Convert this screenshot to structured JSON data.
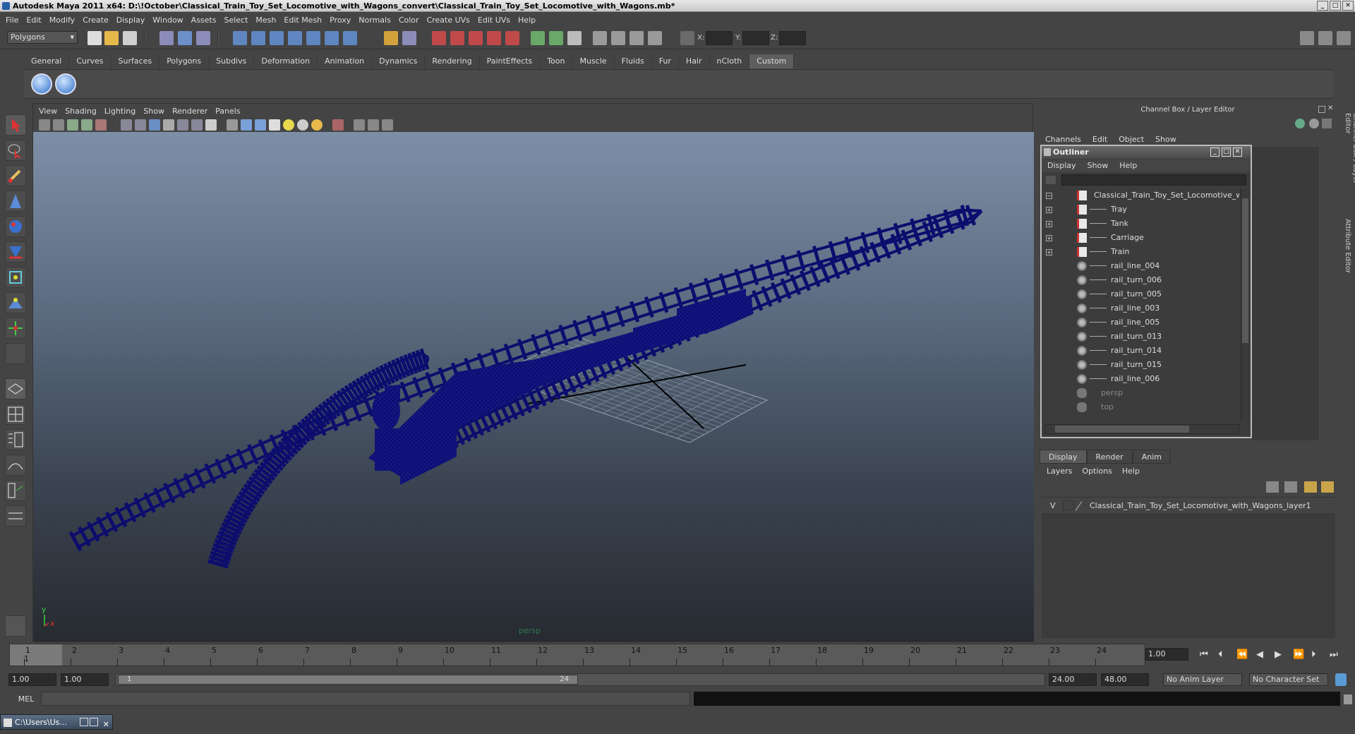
{
  "window": {
    "title": "Autodesk Maya 2011 x64: D:\\!October\\Classical_Train_Toy_Set_Locomotive_with_Wagons_convert\\Classical_Train_Toy_Set_Locomotive_with_Wagons.mb*",
    "minimize": "_",
    "maximize": "□",
    "close": "✕"
  },
  "menubar": [
    "File",
    "Edit",
    "Modify",
    "Create",
    "Display",
    "Window",
    "Assets",
    "Select",
    "Mesh",
    "Edit Mesh",
    "Proxy",
    "Normals",
    "Color",
    "Create UVs",
    "Edit UVs",
    "Help"
  ],
  "statusline": {
    "mode": "Polygons",
    "x_label": "X:",
    "y_label": "Y:",
    "z_label": "Z:"
  },
  "shelf": {
    "tabs": [
      "General",
      "Curves",
      "Surfaces",
      "Polygons",
      "Subdivs",
      "Deformation",
      "Animation",
      "Dynamics",
      "Rendering",
      "PaintEffects",
      "Toon",
      "Muscle",
      "Fluids",
      "Fur",
      "Hair",
      "nCloth",
      "Custom"
    ],
    "active_tab": "Custom"
  },
  "viewport": {
    "menu": [
      "View",
      "Shading",
      "Lighting",
      "Show",
      "Renderer",
      "Panels"
    ],
    "camera_label": "persp",
    "axis_y": "y",
    "axis_x": "x",
    "mesh_color": "#0d0d6e"
  },
  "channel_box": {
    "header": "Channel Box / Layer Editor",
    "menu": [
      "Channels",
      "Edit",
      "Object",
      "Show"
    ],
    "side_tab_1": "Channel Box / Layer Editor",
    "side_tab_2": "Attribute Editor"
  },
  "outliner": {
    "title": "Outliner",
    "menu": [
      "Display",
      "Show",
      "Help"
    ],
    "items": [
      {
        "label": "Classical_Train_Toy_Set_Locomotive_with",
        "expander": "−",
        "icon": "group",
        "indent": 0
      },
      {
        "label": "Tray",
        "expander": "+",
        "icon": "group",
        "indent": 1
      },
      {
        "label": "Tank",
        "expander": "+",
        "icon": "group",
        "indent": 1
      },
      {
        "label": "Carriage",
        "expander": "+",
        "icon": "group",
        "indent": 1
      },
      {
        "label": "Train",
        "expander": "+",
        "icon": "group",
        "indent": 1
      },
      {
        "label": "rail_line_004",
        "expander": "",
        "icon": "mesh",
        "indent": 1
      },
      {
        "label": "rail_turn_006",
        "expander": "",
        "icon": "mesh",
        "indent": 1
      },
      {
        "label": "rail_turn_005",
        "expander": "",
        "icon": "mesh",
        "indent": 1
      },
      {
        "label": "rail_line_003",
        "expander": "",
        "icon": "mesh",
        "indent": 1
      },
      {
        "label": "rail_line_005",
        "expander": "",
        "icon": "mesh",
        "indent": 1
      },
      {
        "label": "rail_turn_013",
        "expander": "",
        "icon": "mesh",
        "indent": 1
      },
      {
        "label": "rail_turn_014",
        "expander": "",
        "icon": "mesh",
        "indent": 1
      },
      {
        "label": "rail_turn_015",
        "expander": "",
        "icon": "mesh",
        "indent": 1
      },
      {
        "label": "rail_line_006",
        "expander": "",
        "icon": "mesh",
        "indent": 1
      },
      {
        "label": "persp",
        "expander": "",
        "icon": "camera",
        "indent": 0
      },
      {
        "label": "top",
        "expander": "",
        "icon": "camera",
        "indent": 0
      }
    ]
  },
  "layer_editor": {
    "tabs": [
      "Display",
      "Render",
      "Anim"
    ],
    "active_tab": "Display",
    "menu": [
      "Layers",
      "Options",
      "Help"
    ],
    "layer": {
      "visible": "V",
      "name": "Classical_Train_Toy_Set_Locomotive_with_Wagons_layer1"
    }
  },
  "timeline": {
    "ticks": [
      "1",
      "2",
      "3",
      "4",
      "5",
      "6",
      "7",
      "8",
      "9",
      "10",
      "11",
      "12",
      "13",
      "14",
      "15",
      "16",
      "17",
      "18",
      "19",
      "20",
      "21",
      "22",
      "23",
      "24"
    ],
    "current_frame_marker": "1",
    "current_frame": "1.00"
  },
  "range": {
    "start": "1.00",
    "playback_start": "1.00",
    "handle_start": "1",
    "handle_end": "24",
    "playback_end": "24.00",
    "end": "48.00",
    "anim_layer": "No Anim Layer",
    "character_set": "No Character Set"
  },
  "command": {
    "label": "MEL"
  },
  "taskbar": {
    "item": "C:\\Users\\Us..."
  }
}
